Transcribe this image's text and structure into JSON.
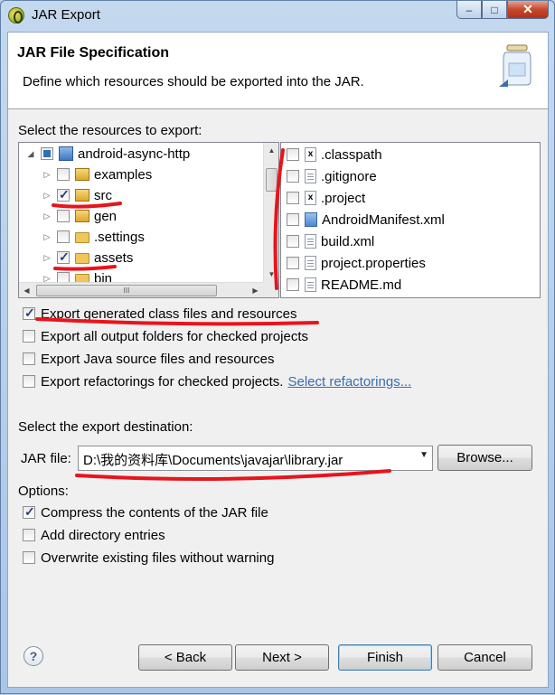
{
  "window": {
    "title": "JAR Export",
    "controls": {
      "minimize": "–",
      "maximize": "□",
      "close": "✕"
    }
  },
  "header": {
    "title": "JAR File Specification",
    "description": "Define which resources should be exported into the JAR."
  },
  "resources": {
    "label": "Select the resources to export:",
    "tree": [
      {
        "label": "android-async-http",
        "state": "partial",
        "icon": "project-icon",
        "expanded": true
      },
      {
        "label": "examples",
        "state": "unchecked",
        "icon": "package-folder-icon"
      },
      {
        "label": "src",
        "state": "checked",
        "icon": "package-folder-icon"
      },
      {
        "label": "gen",
        "state": "unchecked",
        "icon": "package-folder-icon"
      },
      {
        "label": ".settings",
        "state": "unchecked",
        "icon": "folder-icon"
      },
      {
        "label": "assets",
        "state": "checked",
        "icon": "folder-icon"
      },
      {
        "label": "bin",
        "state": "unchecked",
        "icon": "folder-icon"
      }
    ],
    "files": [
      {
        "label": ".classpath",
        "checked": false,
        "icon": "xml-file-icon"
      },
      {
        "label": ".gitignore",
        "checked": false,
        "icon": "file-icon"
      },
      {
        "label": ".project",
        "checked": false,
        "icon": "xml-file-icon"
      },
      {
        "label": "AndroidManifest.xml",
        "checked": false,
        "icon": "manifest-icon"
      },
      {
        "label": "build.xml",
        "checked": false,
        "icon": "file-icon"
      },
      {
        "label": "project.properties",
        "checked": false,
        "icon": "file-icon"
      },
      {
        "label": "README.md",
        "checked": false,
        "icon": "file-icon"
      }
    ],
    "scroll_thumb_glyph": "III"
  },
  "export_options": [
    {
      "label": "Export generated class files and resources",
      "checked": true
    },
    {
      "label": "Export all output folders for checked projects",
      "checked": false
    },
    {
      "label": "Export Java source files and resources",
      "checked": false
    },
    {
      "label": "Export refactorings for checked projects.",
      "checked": false,
      "link": "Select refactorings..."
    }
  ],
  "destination": {
    "label": "Select the export destination:",
    "jar_label": "JAR file:",
    "jar_path": "D:\\我的资料库\\Documents\\javajar\\library.jar",
    "browse": "Browse..."
  },
  "options": {
    "label": "Options:",
    "items": [
      {
        "label": "Compress the contents of the JAR file",
        "checked": true
      },
      {
        "label": "Add directory entries",
        "checked": false
      },
      {
        "label": "Overwrite existing files without warning",
        "checked": false
      }
    ]
  },
  "footer": {
    "help": "?",
    "back": "< Back",
    "next": "Next >",
    "finish": "Finish",
    "cancel": "Cancel"
  },
  "annotation_color": "#e8141c"
}
